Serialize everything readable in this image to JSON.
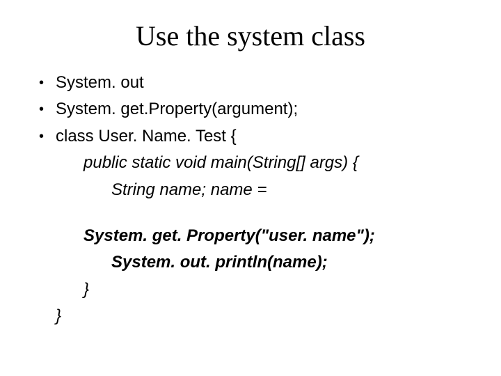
{
  "title": "Use the system class",
  "bullets": [
    "System. out",
    "System. get.Property(argument);",
    "class User. Name. Test {"
  ],
  "code": {
    "line1": "public static void main(String[] args) {",
    "line2": "String name; name =",
    "line3": "System. get. Property(\"user. name\");",
    "line4": "System. out. println(name);",
    "closeInner": "}",
    "closeOuter": "}"
  }
}
